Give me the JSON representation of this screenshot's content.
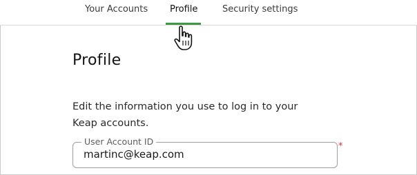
{
  "tabs": [
    {
      "label": "Your Accounts",
      "active": false
    },
    {
      "label": "Profile",
      "active": true
    },
    {
      "label": "Security settings",
      "active": false
    }
  ],
  "colors": {
    "active_tab_underline": "#3a9b3a",
    "required_marker": "#d32f2f"
  },
  "profile": {
    "title": "Profile",
    "description": "Edit the information you use to log in to your Keap accounts.",
    "user_account_field": {
      "label": "User Account ID",
      "value": "martinc@keap.com",
      "required_marker": "*"
    }
  },
  "cursor_icon": "hand-pointer-icon"
}
